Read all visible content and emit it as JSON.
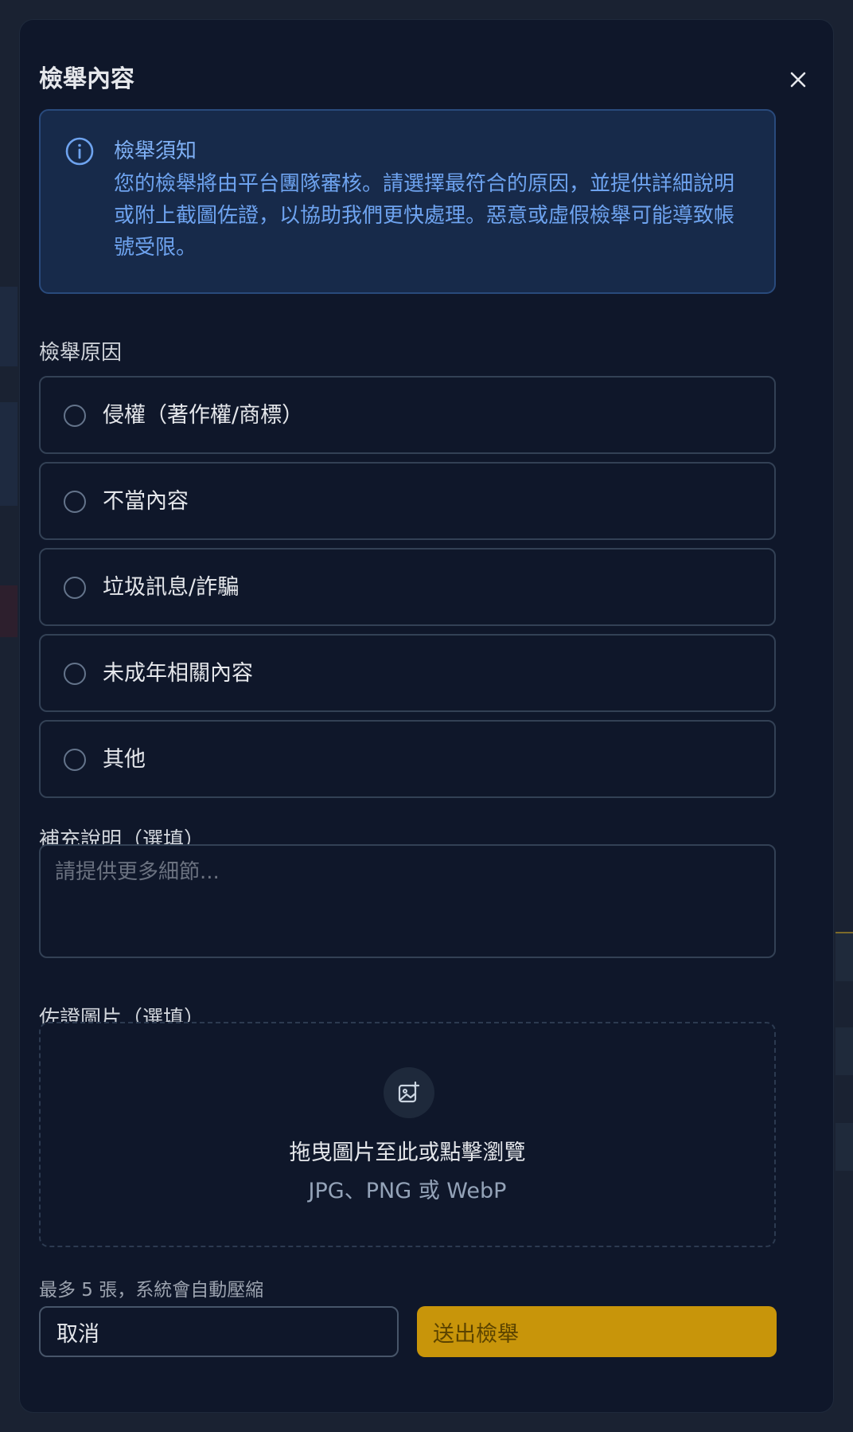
{
  "modal": {
    "title": "檢舉內容"
  },
  "notice": {
    "title": "檢舉須知",
    "body": "您的檢舉將由平台團隊審核。請選擇最符合的原因，並提供詳細說明或附上截圖佐證，以協助我們更快處理。惡意或虛假檢舉可能導致帳號受限。"
  },
  "reason": {
    "label": "檢舉原因",
    "options": [
      {
        "label": "侵權（著作權/商標）"
      },
      {
        "label": "不當內容"
      },
      {
        "label": "垃圾訊息/詐騙"
      },
      {
        "label": "未成年相關內容"
      },
      {
        "label": "其他"
      }
    ]
  },
  "details": {
    "label": "補充說明（選填）",
    "placeholder": "請提供更多細節...",
    "value": ""
  },
  "evidence": {
    "label": "佐證圖片（選填）",
    "drop_title": "拖曳圖片至此或點擊瀏覽",
    "drop_formats": "JPG、PNG 或 WebP",
    "hint": "最多 5 張，系統會自動壓縮"
  },
  "actions": {
    "cancel_label": "取消",
    "submit_label": "送出檢舉"
  },
  "colors": {
    "accent_primary": "#c8950a",
    "notice_text": "#6ea3ef",
    "background": "#0f172a"
  },
  "icons": {
    "close": "close-icon",
    "info": "info-icon",
    "upload": "image-plus-icon"
  }
}
